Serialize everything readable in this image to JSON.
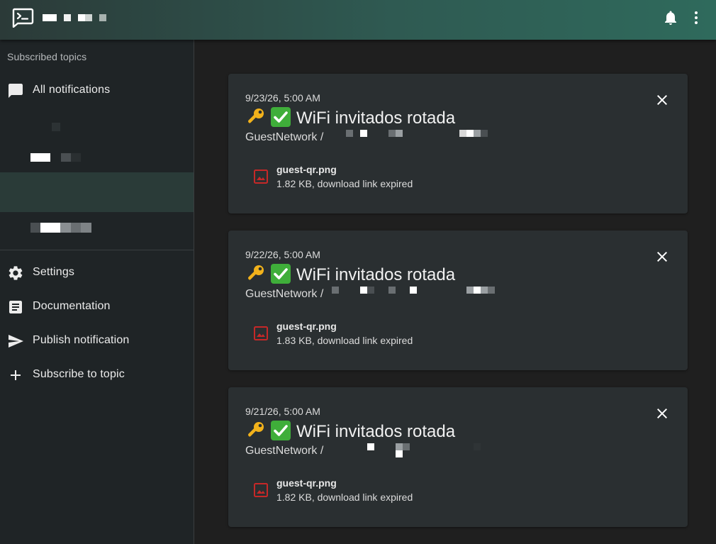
{
  "app": {
    "logo_icon": "terminal-message-icon",
    "title_redacted": true
  },
  "header_actions": {
    "notifications_icon": "bell-icon",
    "menu_icon": "more-vert-icon"
  },
  "sidebar": {
    "header": "Subscribed topics",
    "all_notifications": {
      "label": "All notifications",
      "icon": "chat-bubble-icon"
    },
    "topics_redacted": true,
    "settings": {
      "label": "Settings",
      "icon": "gear-icon"
    },
    "documentation": {
      "label": "Documentation",
      "icon": "article-icon"
    },
    "publish": {
      "label": "Publish notification",
      "icon": "send-icon"
    },
    "subscribe": {
      "label": "Subscribe to topic",
      "icon": "plus-icon"
    }
  },
  "notifications": [
    {
      "date": "9/23/26, 5:00 AM",
      "title": "WiFi invitados rotada",
      "title_emojis": [
        "key",
        "white_check_mark"
      ],
      "tags": "GuestNetwork /",
      "attachment": {
        "name": "guest-qr.png",
        "info": "1.82 KB, download link expired"
      }
    },
    {
      "date": "9/22/26, 5:00 AM",
      "title": "WiFi invitados rotada",
      "title_emojis": [
        "key",
        "white_check_mark"
      ],
      "tags": "GuestNetwork /",
      "attachment": {
        "name": "guest-qr.png",
        "info": "1.83 KB, download link expired"
      }
    },
    {
      "date": "9/21/26, 5:00 AM",
      "title": "WiFi invitados rotada",
      "title_emojis": [
        "key",
        "white_check_mark"
      ],
      "tags": "GuestNetwork /",
      "attachment": {
        "name": "guest-qr.png",
        "info": "1.82 KB, download link expired"
      }
    }
  ],
  "colors": {
    "appbar_start": "#2b3a38",
    "appbar_end": "#2f6a5c",
    "sidebar_bg": "#1f2426",
    "card_bg": "#2a2f31",
    "selected_bg": "#2a3b38",
    "attachment_icon": "#c62828",
    "check_green": "#3fae3a",
    "key_gold": "#f2b21b"
  }
}
